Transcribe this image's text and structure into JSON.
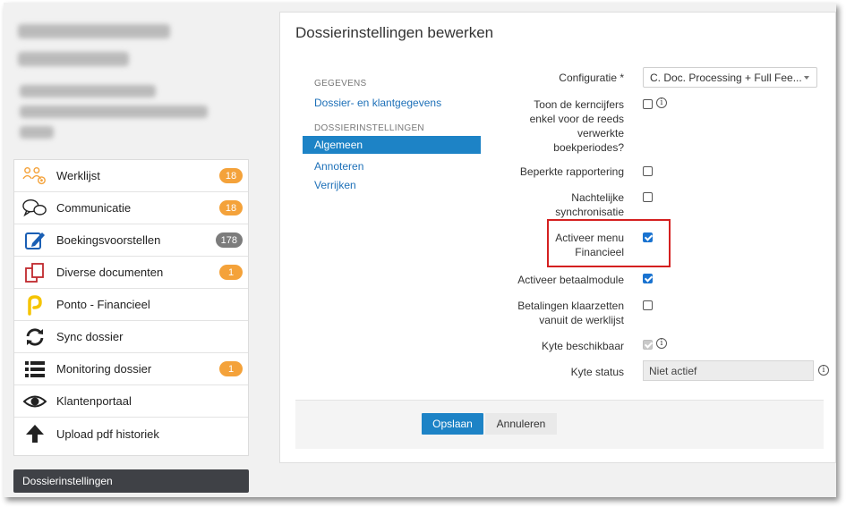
{
  "client": {
    "name_line1": "PRODUCT LIJRLIME &",
    "name_line2": "SCHEERMANS"
  },
  "nav": {
    "items": [
      {
        "label": "Werklijst",
        "icon": "worklist-people-icon",
        "badge": "18"
      },
      {
        "label": "Communicatie",
        "icon": "chat-bubbles-icon",
        "badge": "18"
      },
      {
        "label": "Boekingsvoorstellen",
        "icon": "edit-document-icon",
        "badge": "178"
      },
      {
        "label": "Diverse documenten",
        "icon": "documents-icon",
        "badge": "1"
      },
      {
        "label": "Ponto - Financieel",
        "icon": "ponto-logo-icon",
        "badge": ""
      },
      {
        "label": "Sync dossier",
        "icon": "sync-icon",
        "badge": ""
      },
      {
        "label": "Monitoring dossier",
        "icon": "list-icon",
        "badge": "1"
      },
      {
        "label": "Klantenportaal",
        "icon": "eye-icon",
        "badge": ""
      },
      {
        "label": "Upload pdf historiek",
        "icon": "arrow-up-icon",
        "badge": ""
      }
    ],
    "badge_colors": {
      "orange": "#f4a23a",
      "grey": "#7c7c7c"
    }
  },
  "dossier_button": "Dossierinstellingen",
  "panel": {
    "title": "Dossierinstellingen bewerken",
    "sidebar": {
      "section1": "GEGEVENS",
      "link1": "Dossier- en klantgegevens",
      "section2": "DOSSIERINSTELLINGEN",
      "active": "Algemeen",
      "link2": "Annoteren",
      "link3": "Verrijken"
    },
    "fields": {
      "configuratie_label": "Configuratie *",
      "configuratie_value": "C. Doc. Processing + Full Fee...",
      "kerncijfers_label": "Toon de kerncijfers enkel voor de reeds verwerkte boekperiodes?",
      "rapportering_label": "Beperkte rapportering",
      "synchronisatie_label": "Nachtelijke synchronisatie",
      "financieel_label": "Activeer menu Financieel",
      "betaalmodule_label": "Activeer betaalmodule",
      "betalingen_label": "Betalingen klaarzetten vanuit de werklijst",
      "kyte_label": "Kyte beschikbaar",
      "kyte_status_label": "Kyte status",
      "kyte_status_value": "Niet actief"
    },
    "buttons": {
      "save": "Opslaan",
      "cancel": "Annuleren"
    },
    "accent": "#1d83c6",
    "highlight_color": "#d42020"
  }
}
